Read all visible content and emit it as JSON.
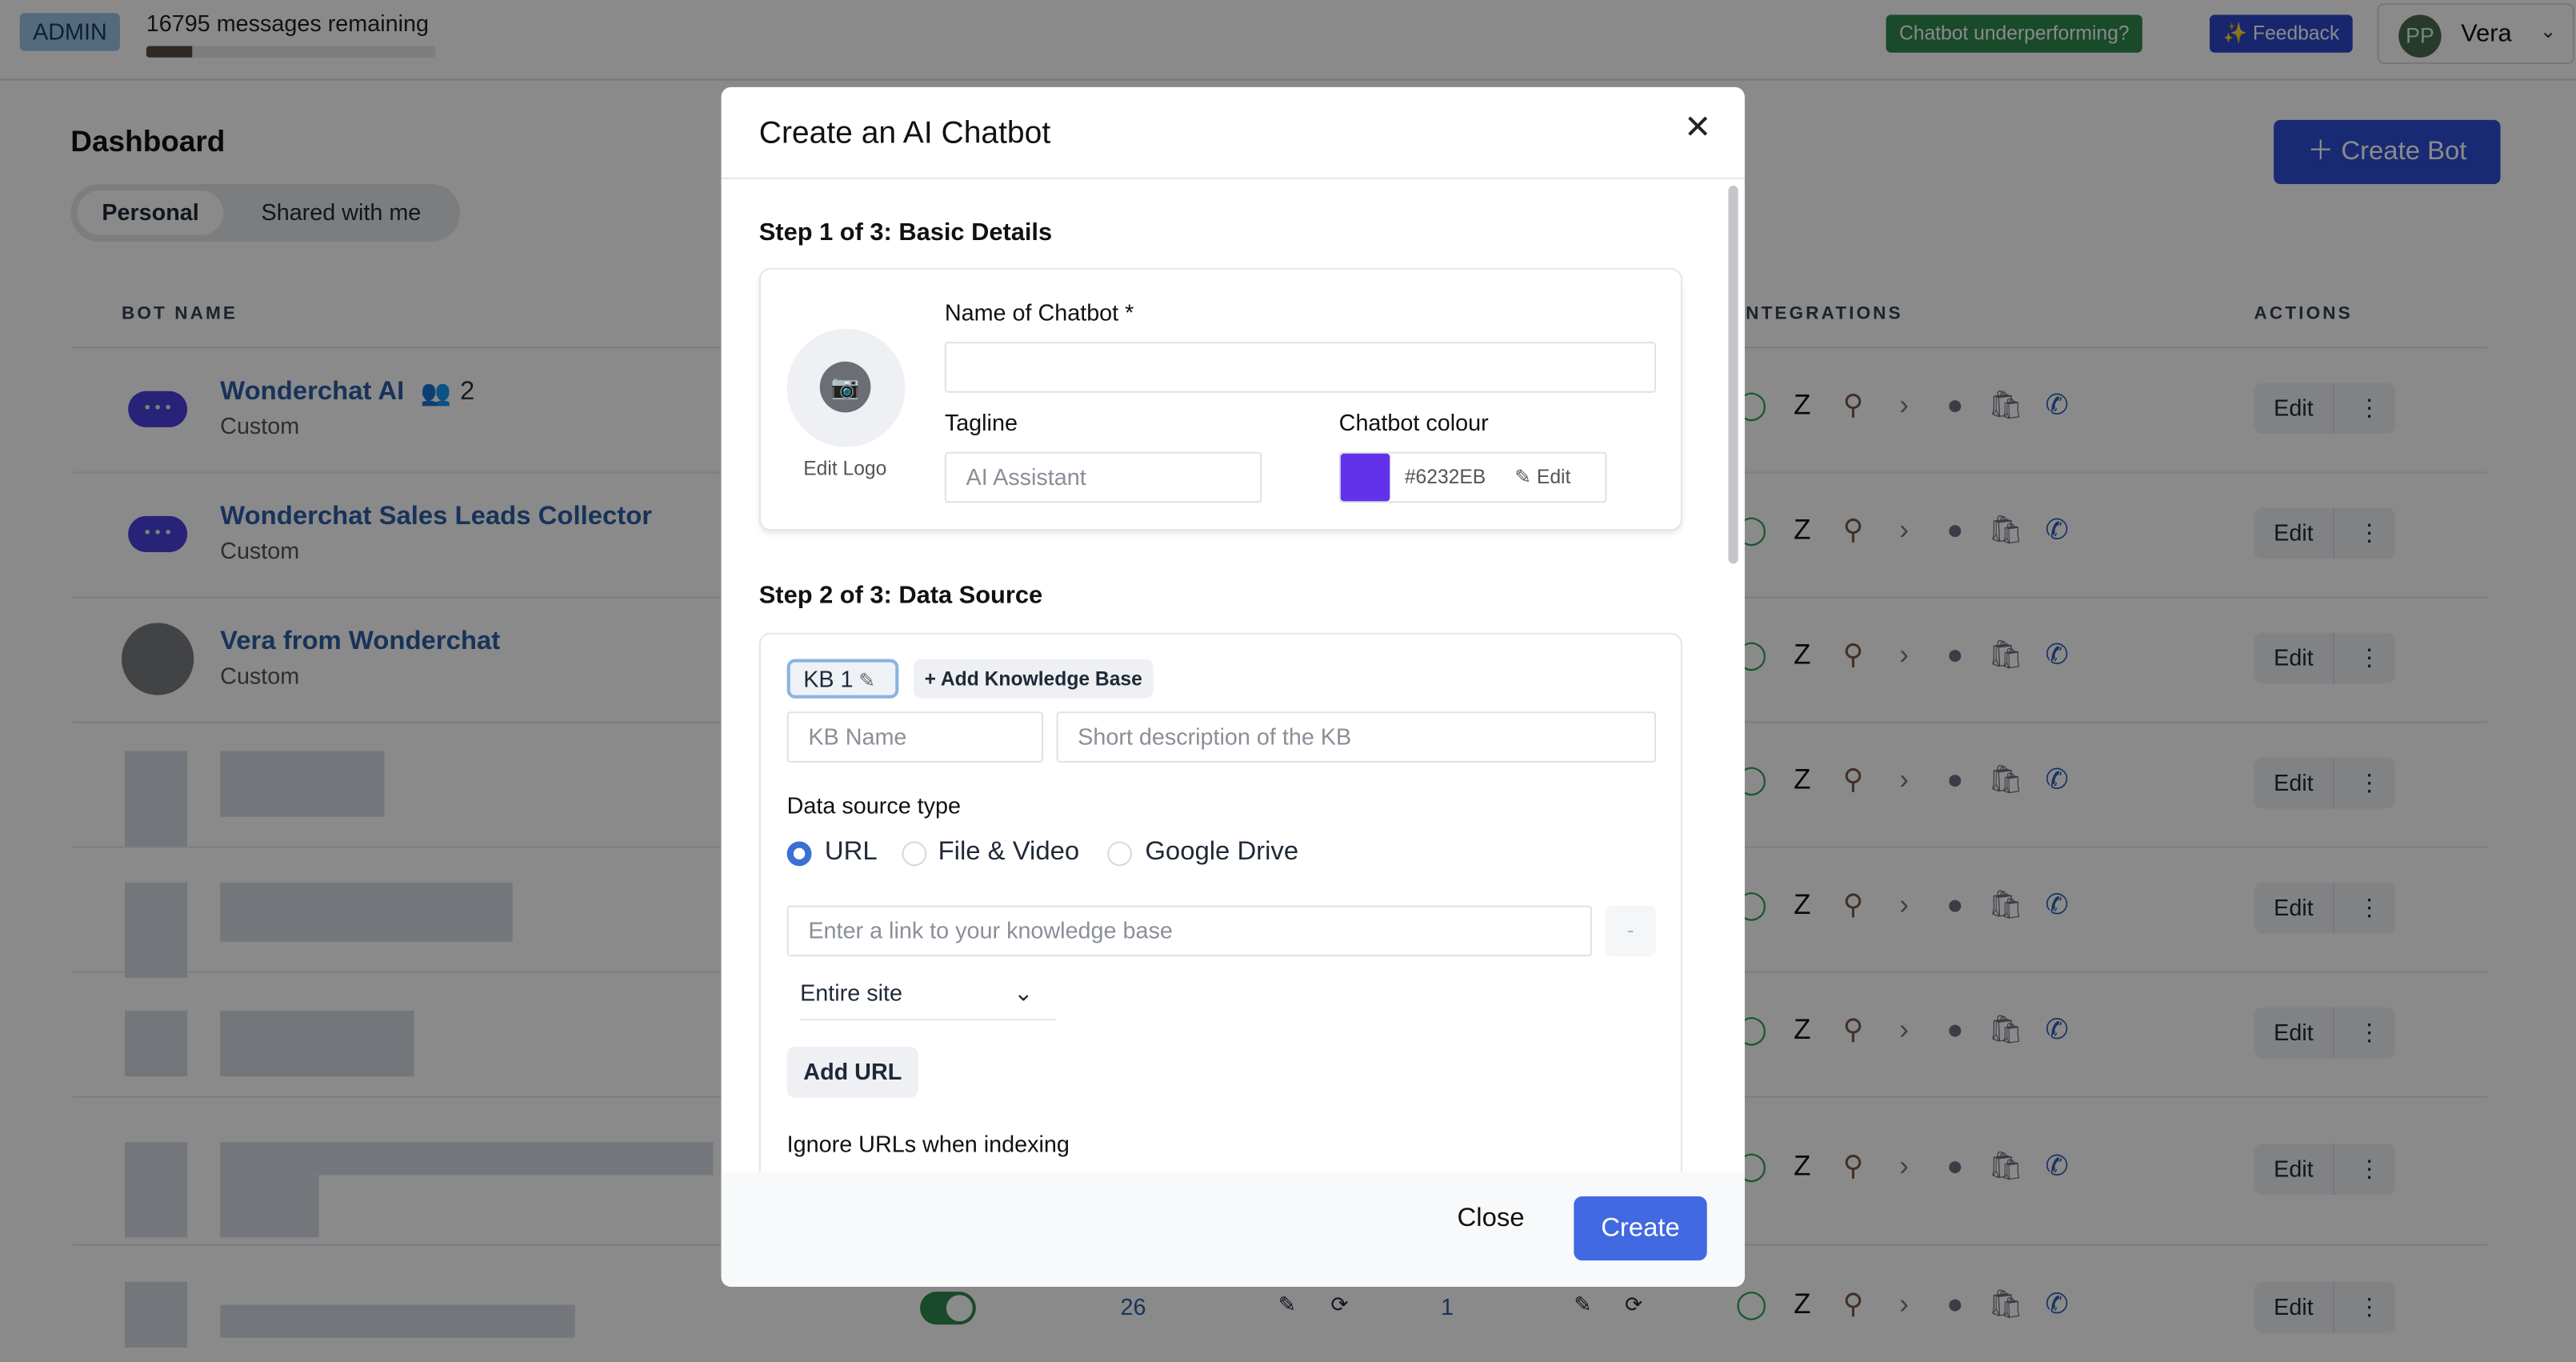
{
  "header": {
    "role_badge": "ADMIN",
    "messages_remaining": "16795 messages remaining",
    "usage_progress": 0.16,
    "underperforming_label": "Chatbot underperforming?",
    "feedback_label": "✨ Feedback",
    "user_initials": "PP",
    "user_name": "Vera"
  },
  "dashboard": {
    "title": "Dashboard",
    "tabs": [
      {
        "label": "Personal",
        "active": true
      },
      {
        "label": "Shared with me",
        "active": false
      }
    ],
    "create_bot_label": "Create Bot",
    "columns": {
      "bot_name": "BOT NAME",
      "integrations": "INTEGRATIONS",
      "actions": "ACTIONS"
    },
    "bots": [
      {
        "name": "Wonderchat AI",
        "type": "Custom",
        "shared_count": "2"
      },
      {
        "name": "Wonderchat Sales Leads Collector",
        "type": "Custom"
      },
      {
        "name": "Vera from Wonderchat",
        "type": "Custom"
      }
    ],
    "edit_label": "Edit",
    "last_row": {
      "count_a": "26",
      "count_b": "1",
      "enabled": true
    }
  },
  "integration_icons": [
    "whatsapp-icon",
    "zendesk-icon",
    "hubspot-icon",
    "zapier-icon",
    "freshdesk-icon",
    "shopify-icon",
    "phone-icon"
  ],
  "modal": {
    "title": "Create an AI Chatbot",
    "step1": {
      "title": "Step 1 of 3: Basic Details",
      "edit_logo": "Edit Logo",
      "name_label": "Name of Chatbot *",
      "name_value": "",
      "tagline_label": "Tagline",
      "tagline_placeholder": "AI Assistant",
      "colour_label": "Chatbot colour",
      "colour_value": "#6232EB",
      "colour_edit": "Edit"
    },
    "step2": {
      "title": "Step 2 of 3: Data Source",
      "kb_tab": "KB 1",
      "add_kb": "+ Add Knowledge Base",
      "kb_name_placeholder": "KB Name",
      "kb_desc_placeholder": "Short description of the KB",
      "source_type_label": "Data source type",
      "source_types": [
        {
          "label": "URL",
          "selected": true
        },
        {
          "label": "File & Video",
          "selected": false
        },
        {
          "label": "Google Drive",
          "selected": false
        }
      ],
      "url_placeholder": "Enter a link to your knowledge base",
      "remove_label": "-",
      "crawl_scope": "Entire site",
      "add_url": "Add URL",
      "ignore_label": "Ignore URLs when indexing"
    },
    "close_label": "Close",
    "create_label": "Create"
  }
}
